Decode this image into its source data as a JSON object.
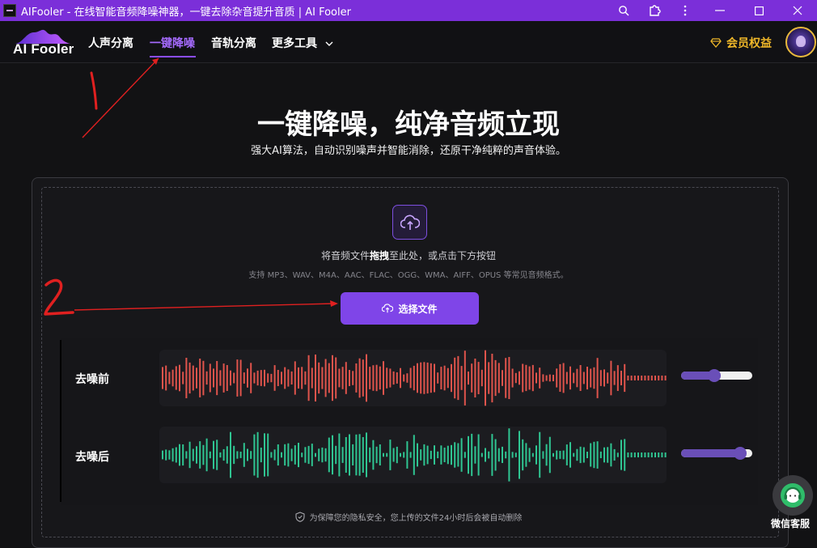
{
  "window": {
    "title": "AIFooler - 在线智能音频降噪神器，一键去除杂音提升音质 | AI Fooler"
  },
  "nav": {
    "logo_text": "AI Fooler",
    "items": [
      {
        "label": "人声分离"
      },
      {
        "label": "一键降噪"
      },
      {
        "label": "音轨分离"
      },
      {
        "label": "更多工具"
      }
    ],
    "vip_label": "会员权益"
  },
  "hero": {
    "title": "一键降噪，纯净音频立现",
    "subtitle": "强大AI算法，自动识别噪声并智能消除，还原干净纯粹的声音体验。"
  },
  "upload": {
    "hint_prefix": "将音频文件",
    "hint_bold": "拖拽",
    "hint_suffix": "至此处，或点击下方按钮",
    "formats": "支持 MP3、WAV、M4A、AAC、FLAC、OGG、WMA、AIFF、OPUS 等常见音频格式。",
    "button_label": "选择文件"
  },
  "compare": {
    "before_label": "去噪前",
    "after_label": "去噪后",
    "before_color": "#e0544c",
    "after_color": "#2fc592",
    "before_volume": 0.46,
    "after_volume": 0.9
  },
  "privacy": "为保障您的隐私安全，您上传的文件24小时后会被自动删除",
  "float": {
    "wechat_label": "微信客服"
  },
  "annotations": {
    "mark_1": "1",
    "mark_2": "2",
    "color": "#e02020"
  },
  "colors": {
    "accent": "#7f45e8",
    "titlebar": "#7b2fd9",
    "vip": "#f0b829"
  }
}
